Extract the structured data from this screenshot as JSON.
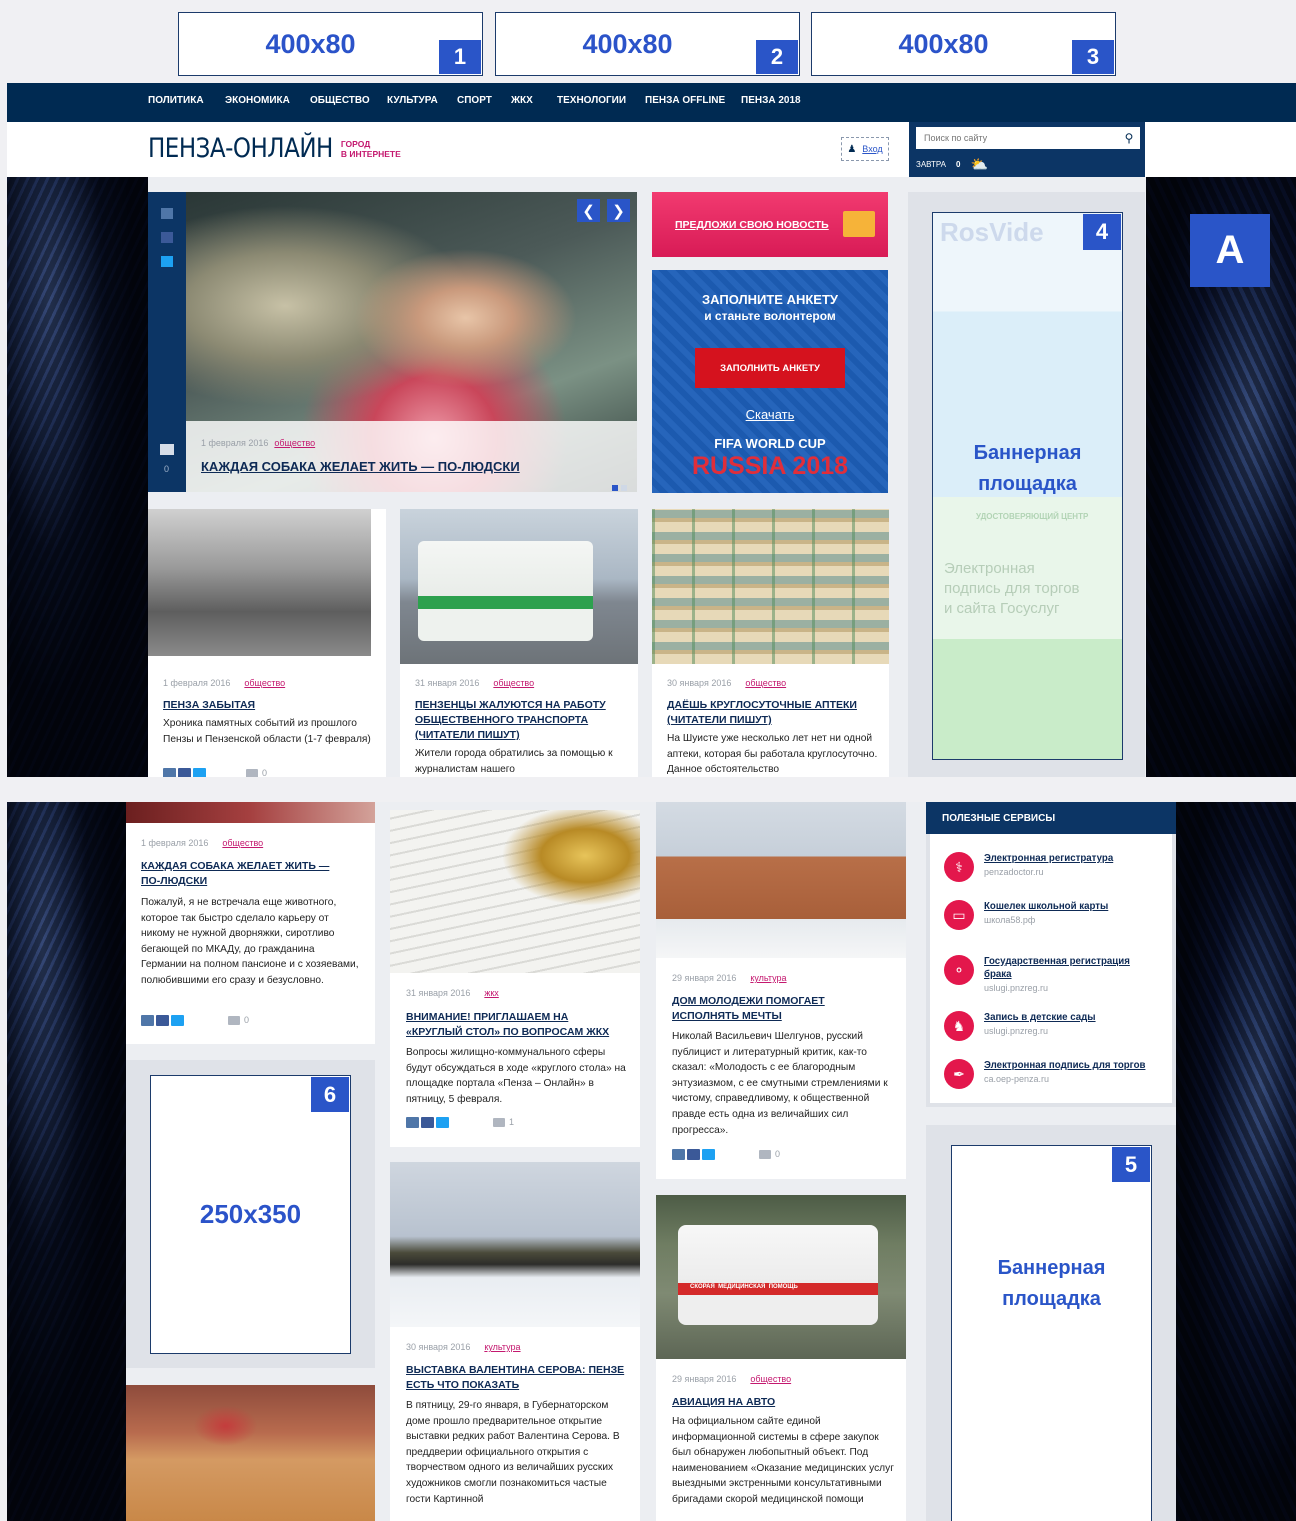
{
  "top_banners": [
    {
      "size": "400x80",
      "badge": "1"
    },
    {
      "size": "400x80",
      "badge": "2"
    },
    {
      "size": "400x80",
      "badge": "3"
    }
  ],
  "nav": [
    "ПОЛИТИКА",
    "ЭКОНОМИКА",
    "ОБЩЕСТВО",
    "КУЛЬТУРА",
    "СПОРТ",
    "ЖКХ",
    "ТЕХНОЛОГИИ",
    "ПЕНЗА OFFLINE",
    "ПЕНЗА 2018"
  ],
  "logo": {
    "main": "ПЕНЗА-ОНЛАЙН",
    "tag1": "ГОРОД",
    "tag2": "В ИНТЕРНЕТЕ"
  },
  "login": "Вход",
  "search": {
    "placeholder": "Поиск по сайту"
  },
  "weather": {
    "label": "ЗАВТРА",
    "value": "0"
  },
  "slider": {
    "date": "1 февраля 2016",
    "category": "общество",
    "title": "КАЖДАЯ СОБАКА ЖЕЛАЕТ ЖИТЬ — ПО-ЛЮДСКИ",
    "comments": "0"
  },
  "suggest": "ПРЕДЛОЖИ СВОЮ НОВОСТЬ",
  "fifa": {
    "line1": "ЗАПОЛНИТЕ АНКЕТУ",
    "line2": "и станьте волонтером",
    "button": "ЗАПОЛНИТЬ АНКЕТУ",
    "download": "Скачать",
    "cup": "FIFA WORLD CUP",
    "russia": "RUSSIA 2018"
  },
  "side_banner": {
    "label1": "Баннерная",
    "label2": "площадка",
    "badge": "4",
    "rosvideo": "RosVide",
    "udc": "УДОСТОВЕРЯЮЩИЙ ЦЕНТР",
    "ep1": "Электронная",
    "ep2": "подпись для торгов",
    "ep3": "и сайта Госуслуг"
  },
  "skin_badge": "A",
  "news_row": [
    {
      "date": "1 февраля 2016",
      "category": "общество",
      "title": "ПЕНЗА ЗАБЫТАЯ",
      "text": "Хроника памятных событий из прошлого Пензы и Пензенской области (1-7 февраля)",
      "comments": "0"
    },
    {
      "date": "31 января 2016",
      "category": "общество",
      "title": "ПЕНЗЕНЦЫ ЖАЛУЮТСЯ НА РАБОТУ ОБЩЕСТВЕННОГО ТРАНСПОРТА (ЧИТАТЕЛИ ПИШУТ)",
      "text": "Жители города обратились за помощью к журналистам нашего"
    },
    {
      "date": "30 января 2016",
      "category": "общество",
      "title": "ДАЁШЬ КРУГЛОСУТОЧНЫЕ АПТЕКИ (ЧИТАТЕЛИ ПИШУТ)",
      "text": "На Шуисте уже несколько лет нет ни одной аптеки, которая бы работала круглосуточно. Данное обстоятельство"
    }
  ],
  "lower": {
    "dog": {
      "date": "1 февраля 2016",
      "category": "общество",
      "title": "КАЖДАЯ СОБАКА ЖЕЛАЕТ ЖИТЬ — ПО-ЛЮДСКИ",
      "text": "Пожалуй, я не встречала еще животного, которое так быстро сделало карьеру от никому не нужной дворняжки, сиротливо бегающей по МКАДу, до гражданина Германии на полном пансионе и с хозяевами, полюбившими его сразу и безусловно.",
      "comments": "0"
    },
    "banner6": {
      "size": "250x350",
      "badge": "6"
    },
    "zhkh": {
      "date": "31 января 2016",
      "category": "жкх",
      "title": "ВНИМАНИЕ! ПРИГЛАШАЕМ НА «КРУГЛЫЙ СТОЛ» ПО ВОПРОСАМ ЖКХ",
      "text": "Вопросы жилищно-коммунального сферы будут обсуждаться в ходе «круглого стола» на площадке портала «Пенза – Онлайн» в пятницу, 5 февраля.",
      "comments": "1"
    },
    "serov": {
      "date": "30 января 2016",
      "category": "культура",
      "title": "ВЫСТАВКА ВАЛЕНТИНА СЕРОВА: ПЕНЗЕ ЕСТЬ ЧТО ПОКАЗАТЬ",
      "text": "В пятницу, 29-го января, в Губернаторском доме прошло предварительное открытие выставки редких работ Валентина Серова. В преддверии официального открытия с творчеством одного из величайших русских художников смогли познакомиться частые гости Картинной"
    },
    "youth": {
      "date": "29 января 2016",
      "category": "культура",
      "title": "ДОМ МОЛОДЕЖИ ПОМОГАЕТ ИСПОЛНЯТЬ МЕЧТЫ",
      "text": "Николай Васильевич Шелгунов, русский публицист и литературный критик, как-то сказал: «Молодость с ее благородным энтузиазмом, с ее смутными стремлениями к чистому, справедливому, к общественной правде есть одна из величайших сил прогресса».",
      "comments": "0"
    },
    "avia": {
      "date": "29 января 2016",
      "category": "общество",
      "title": "АВИАЦИЯ НА АВТО",
      "text": "На официальном сайте единой информационной системы в сфере закупок был обнаружен любопытный объект. Под наименованием «Оказание медицинских услуг выездными экстренными консультативными бригадами скорой медицинской помощи"
    },
    "ambulance_sign": "СКОРАЯ  МЕДИЦИНСКАЯ  ПОМОЩЬ",
    "services_title": "ПОЛЕЗНЫЕ СЕРВИСЫ",
    "services": [
      {
        "title": "Электронная регистратура",
        "url": "penzadoctor.ru",
        "icon": "stethoscope-icon"
      },
      {
        "title": "Кошелек школьной карты",
        "url": "школа58.рф",
        "icon": "card-icon"
      },
      {
        "title": "Государственная регистрация брака",
        "url": "uslugi.pnzreg.ru",
        "icon": "rings-icon"
      },
      {
        "title": "Запись в детские сады",
        "url": "uslugi.pnzreg.ru",
        "icon": "rocking-horse-icon"
      },
      {
        "title": "Электронная подпись для торгов",
        "url": "ca.oep-penza.ru",
        "icon": "signature-icon"
      }
    ],
    "banner5": {
      "label1": "Баннерная",
      "label2": "площадка",
      "badge": "5"
    }
  },
  "colors": {
    "navy": "#002a52",
    "brand_pink": "#c4186f",
    "badge_blue": "#2a55c8",
    "service_red": "#e3174c"
  }
}
